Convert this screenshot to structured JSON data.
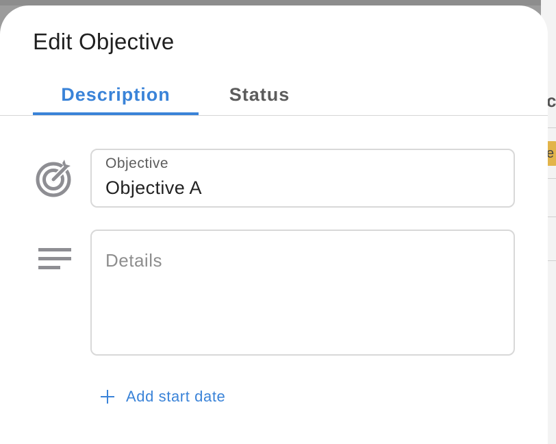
{
  "dialog": {
    "title": "Edit Objective"
  },
  "tabs": [
    {
      "label": "Description",
      "active": true
    },
    {
      "label": "Status",
      "active": false
    }
  ],
  "objective_field": {
    "label": "Objective",
    "value": "Objective A",
    "icon": "target-icon"
  },
  "details_field": {
    "placeholder": "Details",
    "value": "",
    "icon": "notes-lines-icon"
  },
  "add_start_date": {
    "label": "Add start date",
    "icon": "plus-icon"
  },
  "background": {
    "partial_letter": "c",
    "partial_chip": "e"
  },
  "colors": {
    "accent": "#3a83d8",
    "chip": "#e2b44a",
    "text": "#1f1f1f",
    "muted": "#5c5c5c"
  }
}
